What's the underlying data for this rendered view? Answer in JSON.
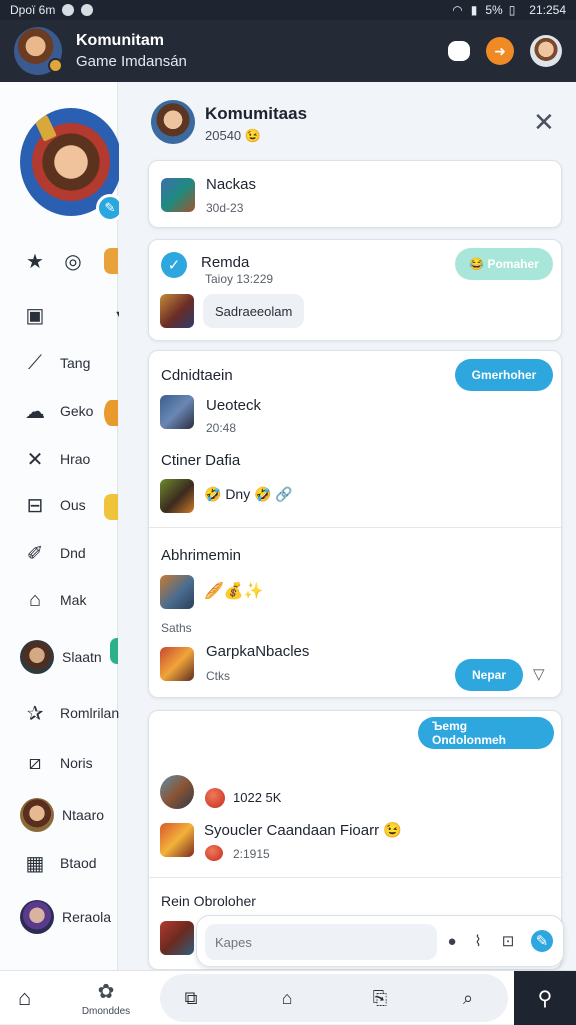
{
  "status_bar": {
    "left": "Dрої 6m",
    "battery": "5%",
    "time": "21:254"
  },
  "app_bar": {
    "title": "Komunitam",
    "subtitle": "Game Imdansán"
  },
  "sidebar": {
    "items": [
      {
        "label": "Tang",
        "icon": "broom-icon"
      },
      {
        "label": "Geko",
        "icon": "cloud-icon"
      },
      {
        "label": "Hrao",
        "icon": "cross-icon"
      },
      {
        "label": "Ous",
        "icon": "box-icon"
      },
      {
        "label": "Dnd",
        "icon": "pen-icon"
      },
      {
        "label": "Mak",
        "icon": "camera-icon"
      },
      {
        "label": "Slaatn",
        "icon": "avatar"
      },
      {
        "label": "Romlrilan",
        "icon": "star-icon"
      },
      {
        "label": "Noris",
        "icon": "frame-icon"
      },
      {
        "label": "Ntaaro",
        "icon": "avatar"
      },
      {
        "label": "Btaod",
        "icon": "grid-icon"
      },
      {
        "label": "Reraola",
        "icon": "avatar"
      }
    ]
  },
  "panel": {
    "title": "Komumitaas",
    "subtitle": "20540 😉",
    "card1": {
      "name": "Nackas",
      "time": "30d-23"
    },
    "card2": {
      "name": "Remda",
      "time": "Taioy 13:229",
      "button": "😂 Pomaher",
      "chip": "Sadraeeolam"
    },
    "card3": {
      "header": "Cdnidtaein",
      "button": "Gmerhoher",
      "user": "Ueoteck",
      "time": "20:48",
      "line": "Ctiner Dafia",
      "reaction_text": "🤣 Dny 🤣 🔗"
    },
    "card4": {
      "header": "Abhrimemin",
      "emojis": "🥖💰✨",
      "small": "Saths",
      "user": "GarpkaNbacles",
      "meta": "Ctks",
      "button": "Nepar"
    },
    "card5": {
      "button": "Ъemg Ondolonmeh",
      "stat": "1022 5K",
      "title": "Syoucler Caandaan Fioarr 😉",
      "stat2": "2:1915",
      "footer": "Rein Obroloher"
    },
    "composer_placeholder": "Kapes"
  },
  "bottom_nav": {
    "community_label": "Dmonddes"
  },
  "colors": {
    "accent": "#2ea7df",
    "appbar": "#242b37",
    "light_button": "#a9e6da"
  }
}
